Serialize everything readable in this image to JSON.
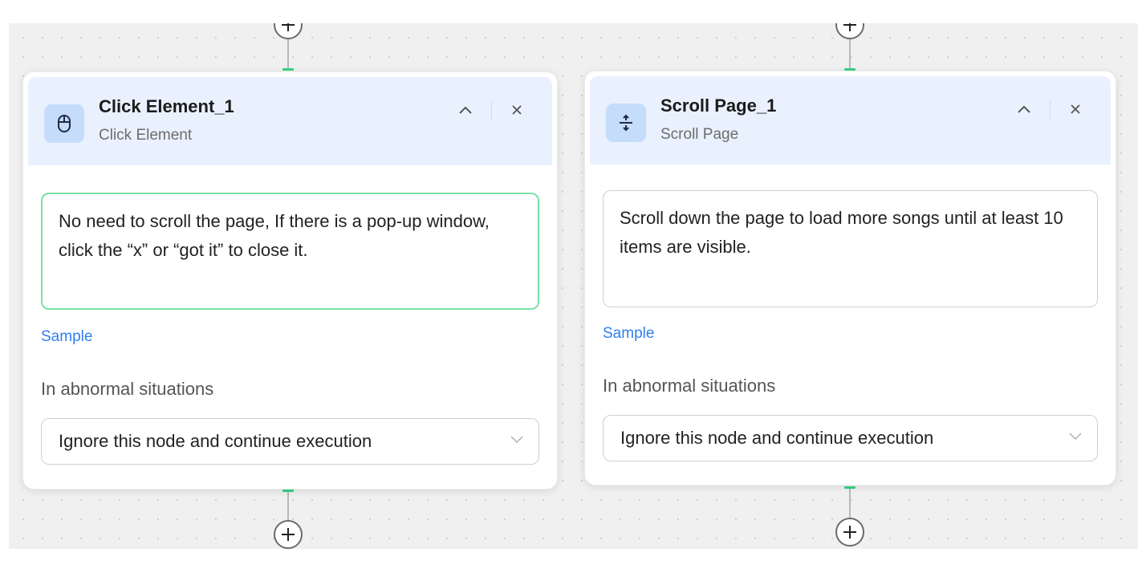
{
  "nodes": [
    {
      "title": "Click Element_1",
      "subtitle": "Click Element",
      "icon": "mouse-icon",
      "prompt": "No need to scroll the page, If there is a pop-up window, click the “x” or “got it” to close it.",
      "prompt_focused": true,
      "sample_label": "Sample",
      "abnormal_label": "In abnormal situations",
      "abnormal_option": "Ignore this node and continue execution"
    },
    {
      "title": "Scroll Page_1",
      "subtitle": "Scroll Page",
      "icon": "scroll-vertical-icon",
      "prompt": "Scroll down the page to load more songs until at least 10 items are visible.",
      "prompt_focused": false,
      "sample_label": "Sample",
      "abnormal_label": "In abnormal situations",
      "abnormal_option": "Ignore this node and continue execution"
    }
  ],
  "icons": {
    "add": "plus-icon",
    "collapse": "chevron-up-icon",
    "close": "close-icon",
    "dropdown": "chevron-down-icon"
  },
  "colors": {
    "canvas": "#f0f0f0",
    "header": "#e9f1fe",
    "icon_bg": "#c6dcfb",
    "link": "#2f7ff0",
    "active_border": "#7be0a6",
    "port": "#32d480"
  }
}
